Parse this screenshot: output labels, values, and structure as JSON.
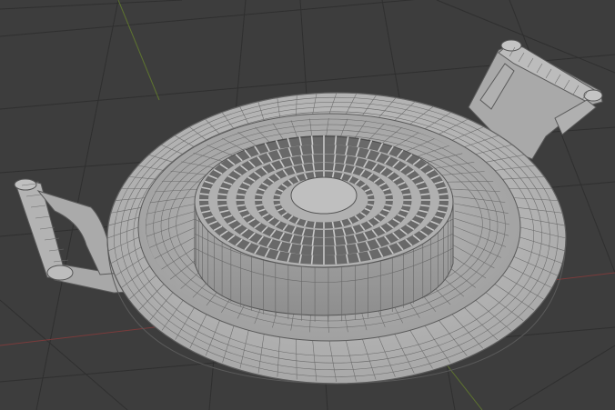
{
  "viewport": {
    "mode": "3d-viewport",
    "shading": "solid-wireframe-overlay",
    "background_color": "#3d3d3d",
    "grid_line_color": "#2f2f2f",
    "axis_x_color": "#8a3b3b",
    "axis_y_color": "#6b8a2a"
  },
  "object": {
    "kind": "paella-pan-mesh",
    "parts": [
      "pan-rim",
      "pan-basin",
      "left-handle",
      "right-handle",
      "center-burner-grate"
    ],
    "surface_color": "#b4b4b4",
    "edge_color": "#5a5a5a"
  }
}
